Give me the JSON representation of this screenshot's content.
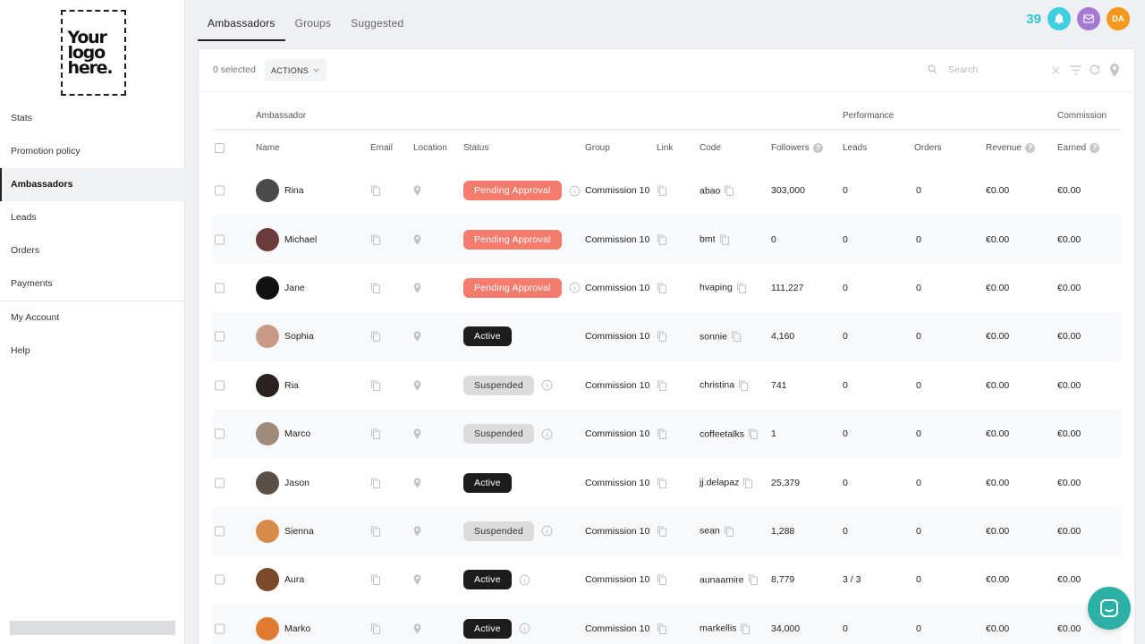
{
  "logo": {
    "line1": "Your",
    "line2": "logo",
    "line3": "here."
  },
  "sidebar": {
    "items": [
      {
        "label": "Stats"
      },
      {
        "label": "Promotion policy"
      },
      {
        "label": "Ambassadors"
      },
      {
        "label": "Leads"
      },
      {
        "label": "Orders"
      },
      {
        "label": "Payments"
      },
      {
        "label": "My Account"
      },
      {
        "label": "Help"
      }
    ],
    "active": "Ambassadors"
  },
  "tabs": [
    {
      "label": "Ambassadors"
    },
    {
      "label": "Groups"
    },
    {
      "label": "Suggested"
    }
  ],
  "header": {
    "notification_count": "39",
    "user_initials": "DA"
  },
  "toolbar": {
    "selected_text": "0 selected",
    "actions_label": "ACTIONS",
    "search_placeholder": "Search"
  },
  "table": {
    "group_headers": {
      "ambassador": "Ambassador",
      "performance": "Performance",
      "commission": "Commission"
    },
    "columns": {
      "name": "Name",
      "email": "Email",
      "location": "Location",
      "status": "Status",
      "group": "Group",
      "link": "Link",
      "code": "Code",
      "followers": "Followers",
      "leads": "Leads",
      "orders": "Orders",
      "revenue": "Revenue",
      "earned": "Earned"
    },
    "rows": [
      {
        "name": "Rina",
        "status": "Pending Approval",
        "status_type": "pending",
        "info": true,
        "group": "Commission 10",
        "code": "abao",
        "followers": "303,000",
        "leads": "0",
        "orders": "0",
        "revenue": "€0.00",
        "earned": "€0.00",
        "avatar_color": "#4a4a4a"
      },
      {
        "name": "Michael",
        "status": "Pending Approval",
        "status_type": "pending",
        "info": false,
        "group": "Commission 10",
        "code": "bmt",
        "followers": "0",
        "leads": "0",
        "orders": "0",
        "revenue": "€0.00",
        "earned": "€0.00",
        "avatar_color": "#6b3a3a"
      },
      {
        "name": "Jane",
        "status": "Pending Approval",
        "status_type": "pending",
        "info": true,
        "group": "Commission 10",
        "code": "hvaping",
        "followers": "111,227",
        "leads": "0",
        "orders": "0",
        "revenue": "€0.00",
        "earned": "€0.00",
        "avatar_color": "#111111"
      },
      {
        "name": "Sophia",
        "status": "Active",
        "status_type": "active",
        "info": false,
        "group": "Commission 10",
        "code": "sonnie",
        "followers": "4,160",
        "leads": "0",
        "orders": "0",
        "revenue": "€0.00",
        "earned": "€0.00",
        "avatar_color": "#c99a86"
      },
      {
        "name": "Ria",
        "status": "Suspended",
        "status_type": "suspended",
        "info": true,
        "group": "Commission 10",
        "code": "christina",
        "followers": "741",
        "leads": "0",
        "orders": "0",
        "revenue": "€0.00",
        "earned": "€0.00",
        "avatar_color": "#2b2220"
      },
      {
        "name": "Marco",
        "status": "Suspended",
        "status_type": "suspended",
        "info": true,
        "group": "Commission 10",
        "code": "coffeetalks",
        "followers": "1",
        "leads": "0",
        "orders": "0",
        "revenue": "€0.00",
        "earned": "€0.00",
        "avatar_color": "#a08a7a"
      },
      {
        "name": "Jason",
        "status": "Active",
        "status_type": "active",
        "info": false,
        "group": "Commission 10",
        "code": "jj.delapaz",
        "followers": "25,379",
        "leads": "0",
        "orders": "0",
        "revenue": "€0.00",
        "earned": "€0.00",
        "avatar_color": "#5a5048"
      },
      {
        "name": "Sienna",
        "status": "Suspended",
        "status_type": "suspended",
        "info": true,
        "group": "Commission 10",
        "code": "sean",
        "followers": "1,288",
        "leads": "0",
        "orders": "0",
        "revenue": "€0.00",
        "earned": "€0.00",
        "avatar_color": "#d98b4a"
      },
      {
        "name": "Aura",
        "status": "Active",
        "status_type": "active",
        "info": true,
        "group": "Commission 10",
        "code": "aunaamire",
        "followers": "8,779",
        "leads": "3 / 3",
        "orders": "0",
        "revenue": "€0.00",
        "earned": "€0.00",
        "avatar_color": "#7a4a2a"
      },
      {
        "name": "Marko",
        "status": "Active",
        "status_type": "active",
        "info": true,
        "group": "Commission 10",
        "code": "markellis",
        "followers": "34,000",
        "leads": "0",
        "orders": "0",
        "revenue": "€0.00",
        "earned": "€0.00",
        "avatar_color": "#e07a30"
      }
    ]
  }
}
